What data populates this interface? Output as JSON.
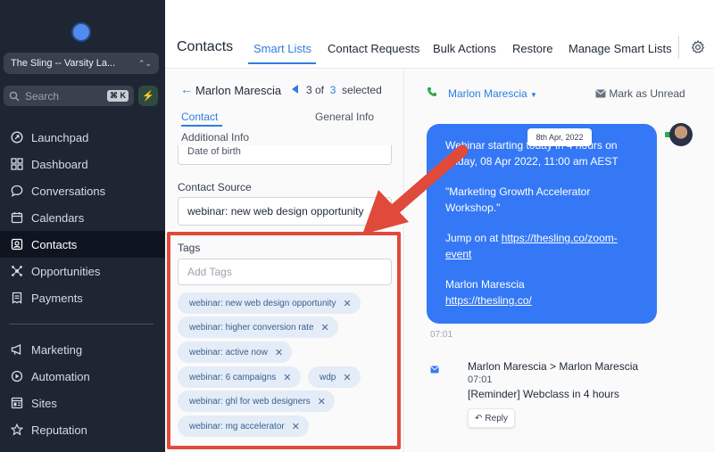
{
  "sidebar": {
    "account": "The Sling -- Varsity La...",
    "search_placeholder": "Search",
    "search_shortcut": "⌘ K",
    "items": [
      {
        "label": "Launchpad",
        "icon": "launchpad-icon"
      },
      {
        "label": "Dashboard",
        "icon": "dashboard-icon"
      },
      {
        "label": "Conversations",
        "icon": "chat-icon"
      },
      {
        "label": "Calendars",
        "icon": "calendar-icon"
      },
      {
        "label": "Contacts",
        "icon": "contacts-icon",
        "active": true
      },
      {
        "label": "Opportunities",
        "icon": "opportunities-icon"
      },
      {
        "label": "Payments",
        "icon": "payments-icon"
      },
      {
        "label": "Marketing",
        "icon": "marketing-icon"
      },
      {
        "label": "Automation",
        "icon": "automation-icon"
      },
      {
        "label": "Sites",
        "icon": "sites-icon"
      },
      {
        "label": "Reputation",
        "icon": "star-icon"
      }
    ]
  },
  "header": {
    "title": "Contacts",
    "tabs": [
      "Smart Lists",
      "Contact Requests",
      "Bulk Actions",
      "Restore",
      "Manage Smart Lists"
    ],
    "active_tab": "Smart Lists"
  },
  "contact": {
    "name": "Marlon Marescia",
    "pager_prefix": "3 of",
    "pager_current": "3",
    "pager_suffix": "selected",
    "tabs": [
      "Contact",
      "General Info",
      "Additional Info"
    ],
    "date_of_birth_placeholder": "Date of birth",
    "contact_source_label": "Contact Source",
    "contact_source_value": "webinar: new web design opportunity",
    "tags_label": "Tags",
    "tags_placeholder": "Add Tags",
    "tags": [
      "webinar: new web design opportunity",
      "webinar: higher conversion rate",
      "webinar: active now",
      "webinar: 6 campaigns",
      "wdp",
      "webinar: ghl for web designers",
      "webinar: mg accelerator"
    ]
  },
  "conversation": {
    "contact_name": "Marlon Marescia",
    "mark_unread": "Mark as Unread",
    "date_pill": "8th Apr, 2022",
    "message_lines": [
      "Webinar starting today in 4 hours on Friday, 08 Apr 2022, 11:00 am  AEST",
      "\"Marketing Growth Accelerator Workshop.\"",
      "Jump on at https://thesling.co/zoom-event",
      "Marlon Marescia https://thesling.co/"
    ],
    "msg_p1": "Webinar starting today in 4 hours on Friday, 08 Apr 2022, 11:00 am  AEST",
    "msg_p2": "\"Marketing Growth Accelerator Workshop.\"",
    "msg_p3_prefix": "Jump on at ",
    "msg_p3_link": "https://thesling.co/zoom-event",
    "msg_p4_name": "Marlon Marescia",
    "msg_p4_link": "https://thesling.co/",
    "message_time": "07:01",
    "email_from": "Marlon Marescia > Marlon Marescia",
    "email_time": "07:01",
    "email_subject": "[Reminder] Webclass in 4 hours",
    "reply_label": "Reply"
  },
  "colors": {
    "sidebar_bg": "#1e2533",
    "accent_blue": "#2f7ee0",
    "bubble_blue": "#3478f6",
    "annotation_red": "#e04a3b",
    "tag_chip_bg": "#e3ecf7"
  }
}
